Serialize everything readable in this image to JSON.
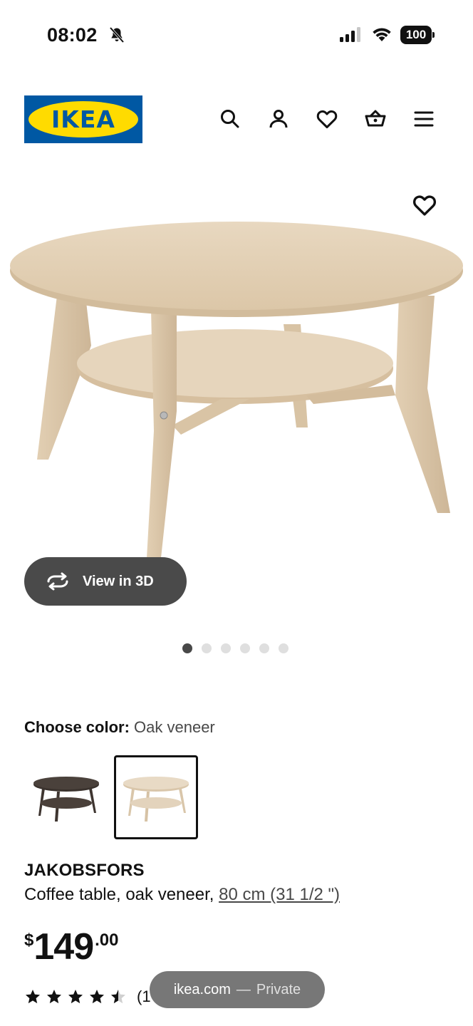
{
  "status_bar": {
    "time": "08:02",
    "battery": "100",
    "icons": [
      "bell-slash-icon",
      "signal-icon",
      "wifi-icon",
      "battery-icon"
    ]
  },
  "header": {
    "logo_text": "IKEA",
    "logo_colors": {
      "background": "#0058a3",
      "ellipse": "#ffdb00"
    },
    "icons": [
      "search-icon",
      "account-icon",
      "heart-icon",
      "cart-icon",
      "menu-icon"
    ]
  },
  "gallery": {
    "view_3d_label": "View in 3D",
    "dot_count": 6,
    "active_dot": 1
  },
  "color_chooser": {
    "label": "Choose color:",
    "value": "Oak veneer",
    "options": [
      {
        "name": "dark-brown",
        "selected": false
      },
      {
        "name": "oak-veneer",
        "selected": true
      }
    ]
  },
  "product": {
    "name": "JAKOBSFORS",
    "description": "Coffee table, oak veneer, ",
    "size": "80 cm (31 1/2 \")",
    "price": {
      "currency": "$",
      "main": "149",
      "decimals": ".00"
    },
    "rating": {
      "value": 4.5,
      "max": 5
    },
    "review_count": "(1"
  },
  "browser": {
    "domain": "ikea.com",
    "separator": "—",
    "mode": "Private"
  },
  "colors": {
    "ikea_blue": "#0058a3",
    "ikea_yellow": "#ffdb00",
    "oak": "#e2cfb4",
    "dark_button": "#4a4a4a"
  }
}
